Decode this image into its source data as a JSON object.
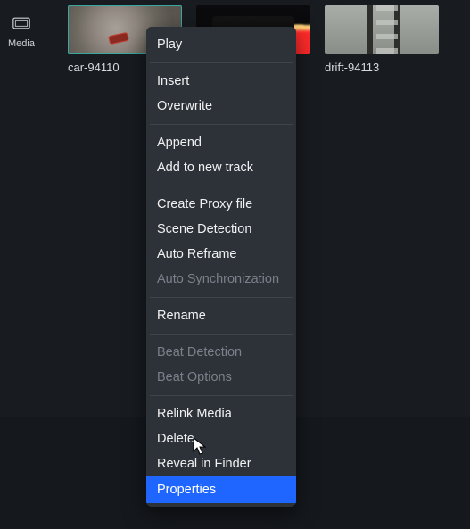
{
  "sidebar": {
    "media_label": "Media"
  },
  "clips": [
    {
      "caption": "car-94110"
    },
    {
      "caption": ""
    },
    {
      "caption": "drift-94113"
    }
  ],
  "menu": {
    "play": "Play",
    "insert": "Insert",
    "overwrite": "Overwrite",
    "append": "Append",
    "add_to_new_track": "Add to new track",
    "create_proxy": "Create Proxy file",
    "scene_detection": "Scene Detection",
    "auto_reframe": "Auto Reframe",
    "auto_sync": "Auto Synchronization",
    "rename": "Rename",
    "beat_detection": "Beat Detection",
    "beat_options": "Beat Options",
    "relink_media": "Relink Media",
    "delete": "Delete",
    "reveal_in_finder": "Reveal in Finder",
    "properties": "Properties"
  }
}
